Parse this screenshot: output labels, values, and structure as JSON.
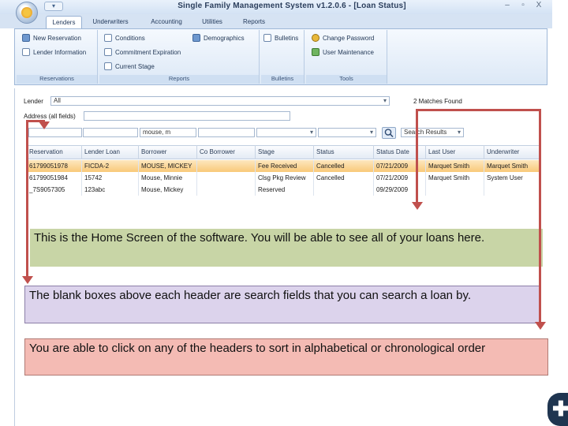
{
  "window": {
    "title": "Single Family Management System v1.2.0.6 - [Loan Status]",
    "quick_access": "▾",
    "min": "–",
    "restore": "▫",
    "close": "X"
  },
  "tabs": [
    "Lenders",
    "Underwriters",
    "Accounting",
    "Utilities",
    "Reports"
  ],
  "ribbon": {
    "groups": [
      {
        "label": "Reservations",
        "items": [
          "New Reservation",
          "Lender Information"
        ]
      },
      {
        "label": "Reports",
        "items": [
          "Conditions",
          "Commitment Expiration",
          "Current Stage",
          "Demographics"
        ]
      },
      {
        "label": "Bulletins",
        "items": [
          "Bulletins"
        ]
      },
      {
        "label": "Tools",
        "items": [
          "Change Password",
          "User Maintenance"
        ]
      }
    ]
  },
  "filters": {
    "lender_label": "Lender",
    "lender_value": "All",
    "matches": "2 Matches Found",
    "address_label": "Address (all fields)",
    "borrower_search": "mouse, m",
    "results_dropdown": "Search Results"
  },
  "grid": {
    "headers": [
      "Reservation",
      "Lender Loan",
      "Borrower",
      "Co Borrower",
      "Stage",
      "Status",
      "Status Date",
      "Last User",
      "Underwriter"
    ],
    "rows": [
      [
        "61799051978",
        "FICDA-2",
        "MOUSE, MICKEY",
        "",
        "Fee Received",
        "Cancelled",
        "07/21/2009",
        "Marquet Smith",
        "Marquet Smith"
      ],
      [
        "61799051984",
        "15742",
        "Mouse, Minnie",
        "",
        "Clsg Pkg Review",
        "Cancelled",
        "07/21/2009",
        "Marquet Smith",
        "System User"
      ],
      [
        "_7S9057305",
        "123abc",
        "Mouse, Mickey",
        "",
        "Reserved",
        "",
        "09/29/2009",
        "",
        ""
      ]
    ]
  },
  "callouts": [
    "This is the Home Screen of the software. You will be able to see all of your loans here.",
    "The blank boxes above each header are search fields that you can search a loan by.",
    "You are able to click on any of the headers to sort in alphabetical or chronological order"
  ],
  "colors": {
    "accent_arrow": "#c0504d",
    "selected_row": "#f9c979",
    "callout1": "#c8d5a6",
    "callout2": "#dcd3ec",
    "callout3": "#f4bbb4"
  }
}
